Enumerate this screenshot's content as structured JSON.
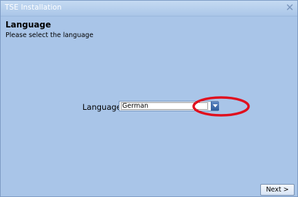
{
  "window": {
    "title": "TSE Installation",
    "close_glyph": "✕"
  },
  "header": {
    "title": "Language",
    "subtitle": "Please select the language"
  },
  "language": {
    "label": "Language:",
    "selected": "German"
  },
  "footer": {
    "next_label": "Next >"
  },
  "colors": {
    "background": "#a9c5e8",
    "annotation": "#e0101e",
    "dropdown_button": "#2f5c9b"
  },
  "icons": {
    "close": "close-icon",
    "dropdown": "chevron-down-icon"
  }
}
